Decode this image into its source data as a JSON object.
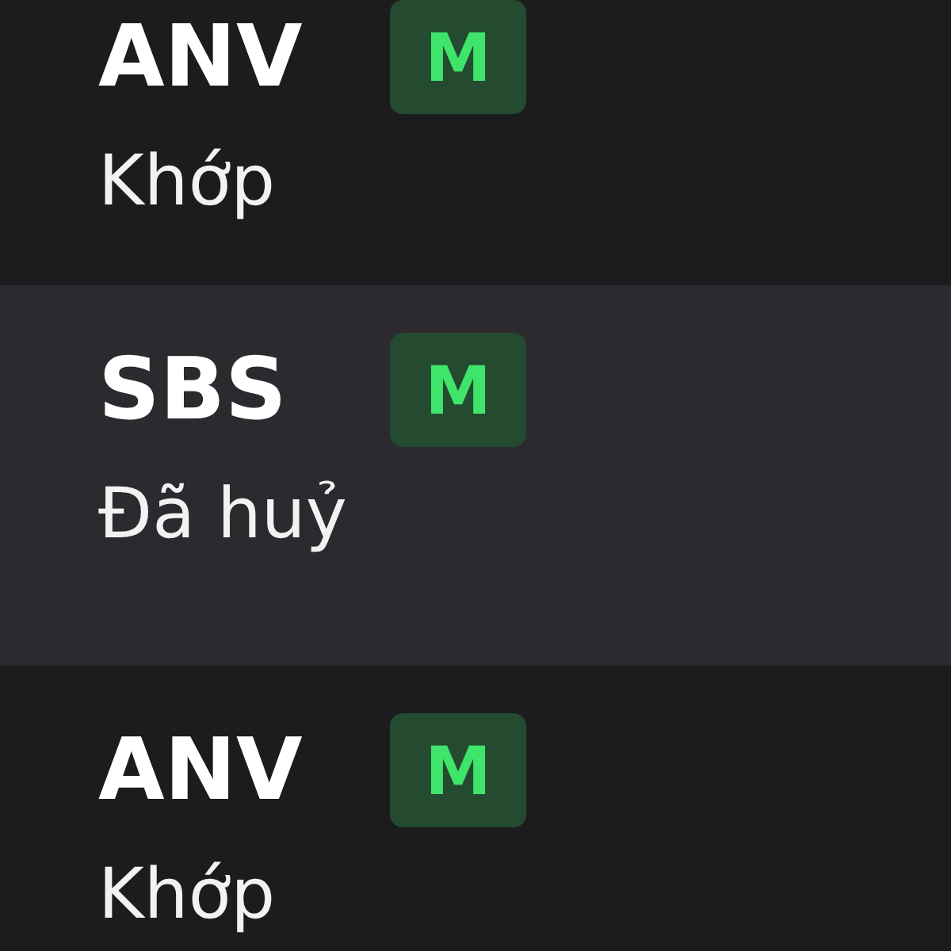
{
  "orders": [
    {
      "ticker": "ANV",
      "badge": "M",
      "status": "Khớp",
      "selected": false
    },
    {
      "ticker": "SBS",
      "badge": "M",
      "status": "Đã huỷ",
      "selected": true
    },
    {
      "ticker": "ANV",
      "badge": "M",
      "status": "Khớp",
      "selected": false
    }
  ]
}
